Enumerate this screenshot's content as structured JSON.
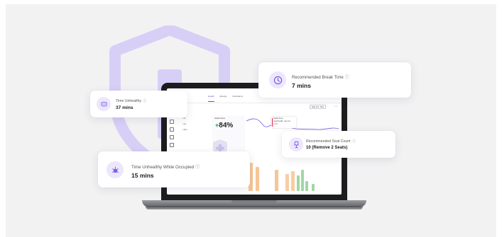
{
  "colors": {
    "accent": "#7b5ce6",
    "shield": "#d8cff7",
    "background": "#f2f2f3"
  },
  "cards": {
    "break_time": {
      "title": "Recommended Break Time",
      "value": "7 mins",
      "icon": "clock-icon",
      "info_icon": "info-icon"
    },
    "time_unhealthy": {
      "title": "Time Unhealthy",
      "value": "37 mins",
      "icon": "mask-icon",
      "info_icon": "info-icon"
    },
    "seat_count": {
      "title": "Recommended Seat Count",
      "value": "10 (Remove 2 Seats)",
      "icon": "seat-icon",
      "info_icon": "info-icon"
    },
    "occupied": {
      "title": "Time Unhealthy While Occupied",
      "value": "15 mins",
      "icon": "virus-icon",
      "info_icon": "info-icon"
    }
  },
  "app": {
    "tabs": [
      "Health",
      "Energy",
      "Occupancy"
    ],
    "breadcrumb": "Health / All Groups",
    "filter_label": "Sep 1st - Nov",
    "pager": "< >",
    "list": [
      "• Au",
      "• Ed",
      "• Elsa"
    ],
    "health_label": "Health Score",
    "health_value": "84%",
    "health_sign": "+",
    "tooltip": {
      "title": "Health Score",
      "line": "Good Health · Sep 1st",
      "badge": "1.4% ↓"
    }
  }
}
